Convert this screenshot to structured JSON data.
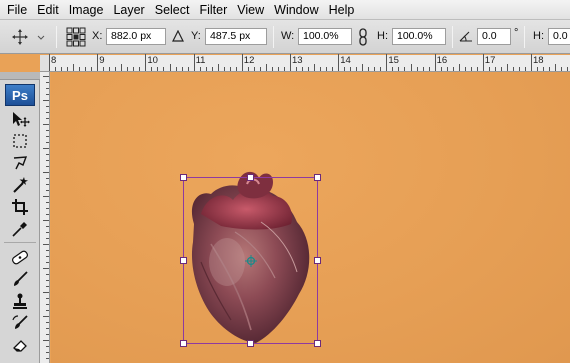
{
  "menubar": {
    "items": [
      "File",
      "Edit",
      "Image",
      "Layer",
      "Select",
      "Filter",
      "View",
      "Window",
      "Help"
    ]
  },
  "options": {
    "x_label": "X:",
    "x_value": "882.0 px",
    "y_label": "Y:",
    "y_value": "487.5 px",
    "w_label": "W:",
    "w_value": "100.0%",
    "h_label": "H:",
    "h_value": "100.0%",
    "angle_value": "0.0",
    "angle_unit": "°",
    "hskew_label": "H:",
    "hskew_value": "0.0"
  },
  "toolbar": {
    "logo": "Ps",
    "tools": [
      "move-tool",
      "rectangular-marquee-tool",
      "lasso-tool",
      "magic-wand-tool",
      "crop-tool",
      "eyedropper-tool",
      "healing-brush-tool",
      "brush-tool",
      "clone-stamp-tool",
      "history-brush-tool",
      "eraser-tool"
    ]
  },
  "ruler": {
    "labels": [
      "8",
      "9",
      "10",
      "11",
      "12",
      "13",
      "14",
      "15",
      "16",
      "17",
      "18"
    ]
  },
  "colors": {
    "canvas_background": "#e9a257",
    "transform_box": "#8e3aa0",
    "app_chrome": "#d6d6d6"
  }
}
